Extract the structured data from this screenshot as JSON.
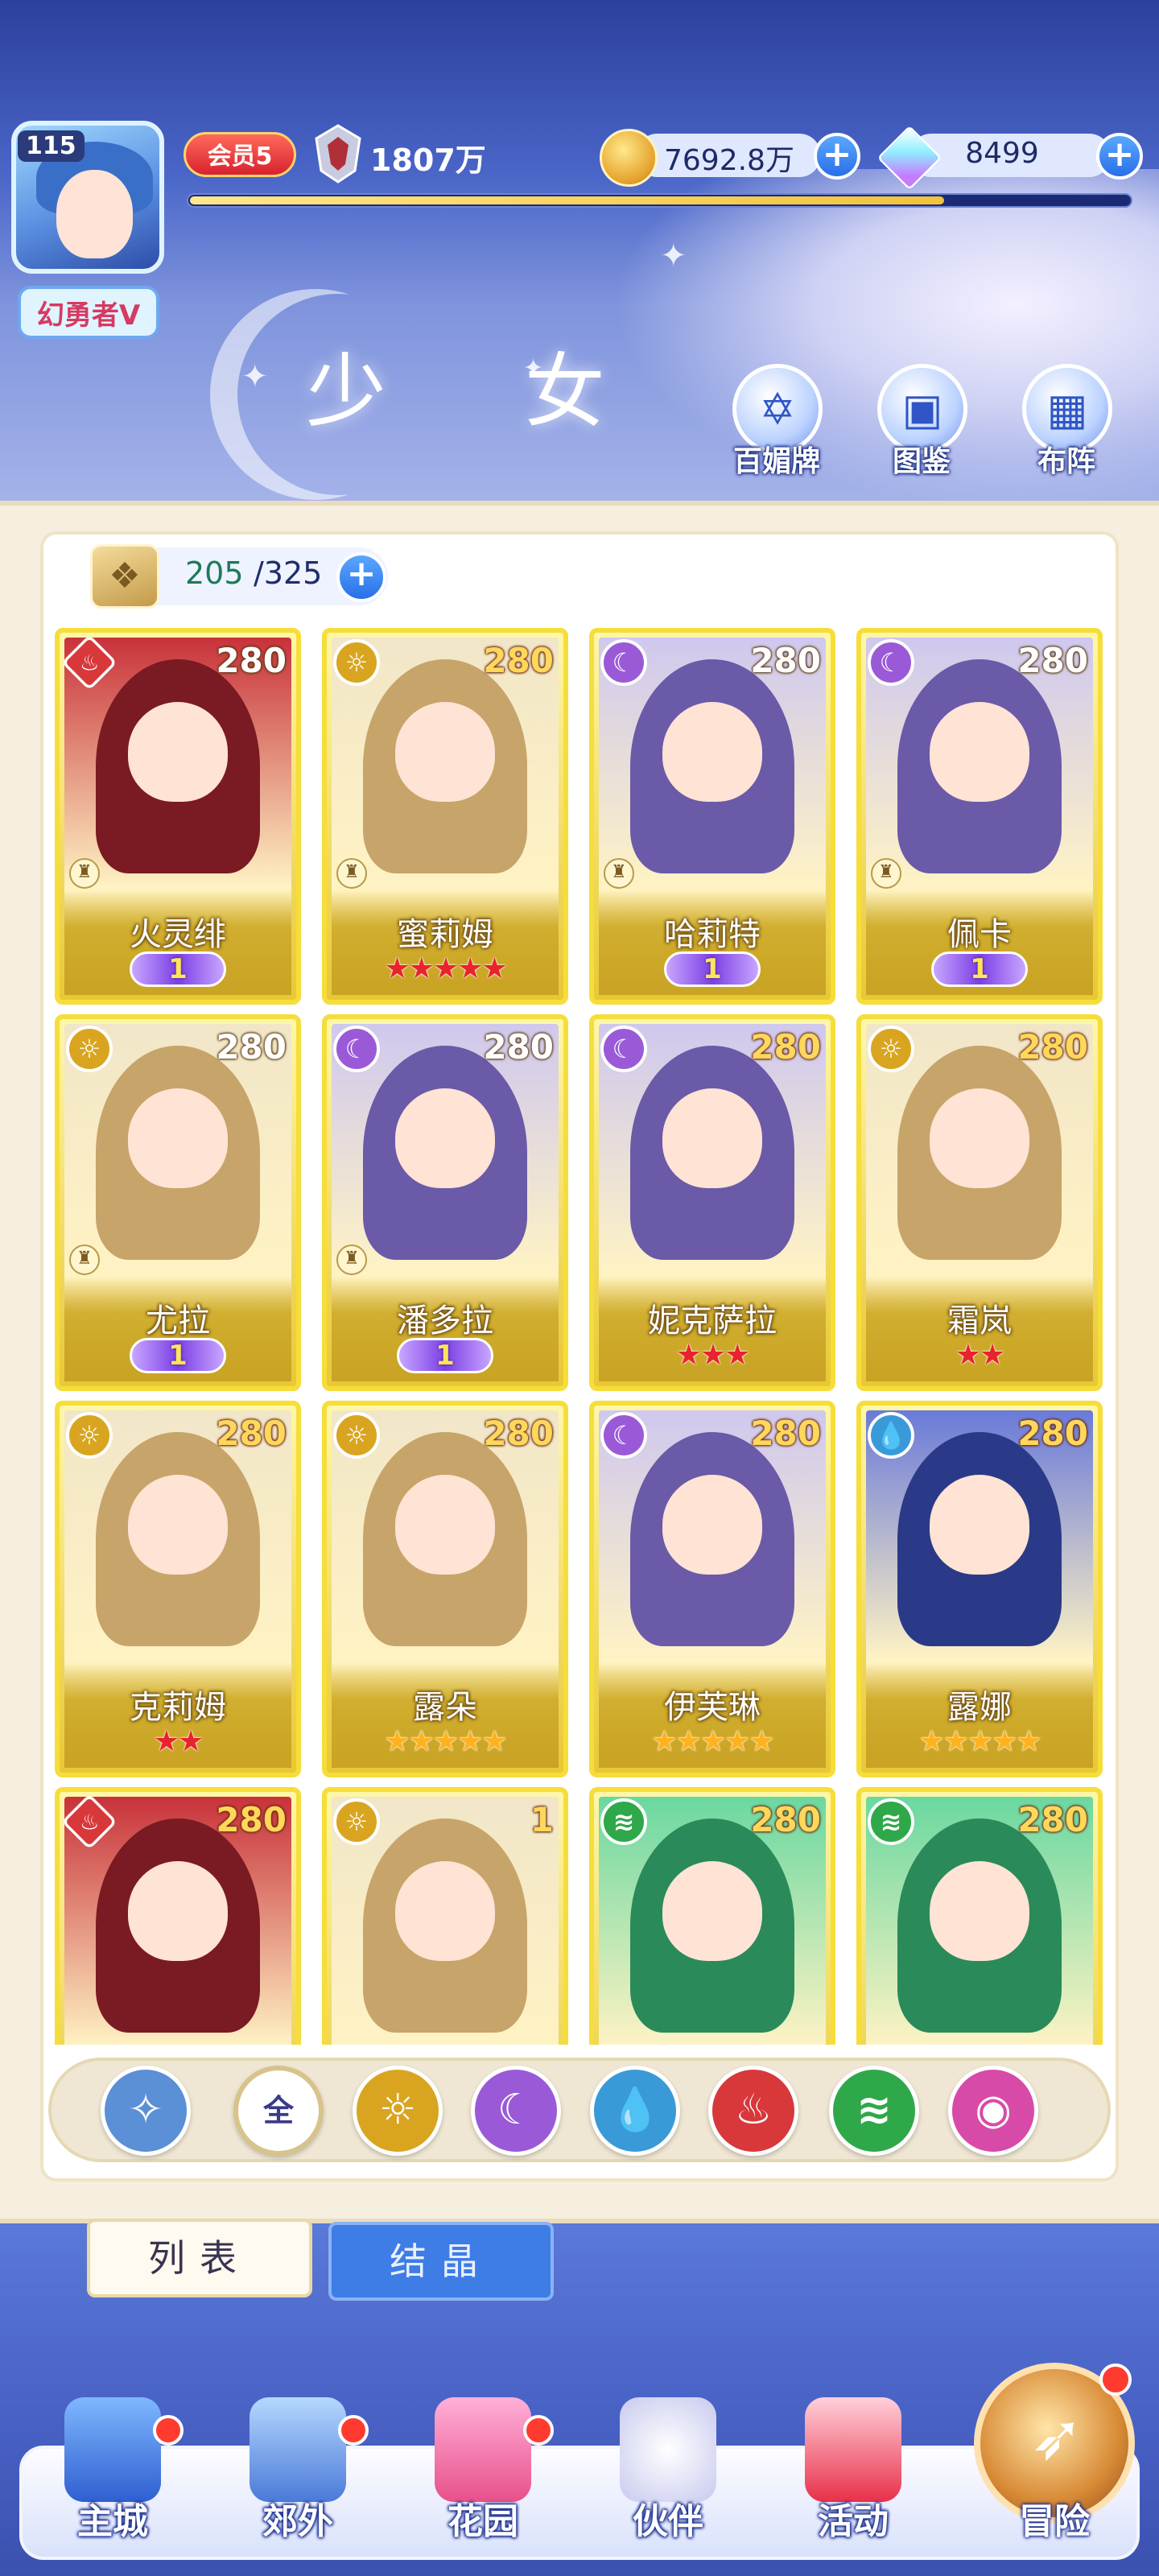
{
  "profile": {
    "level": "115",
    "name": "幻勇者V",
    "member_label": "会员5",
    "power": "1807万",
    "exp_fraction": 0.8
  },
  "currency": {
    "coins": "7692.8万",
    "gems": "8499"
  },
  "page_title": "少 女",
  "header_buttons": [
    {
      "label": "百媚牌",
      "icon": "star-badge-icon"
    },
    {
      "label": "图鉴",
      "icon": "book-icon"
    },
    {
      "label": "布阵",
      "icon": "grid-icon"
    }
  ],
  "collection": {
    "current": "205",
    "max": "/325"
  },
  "cards": [
    {
      "name": "火灵绯",
      "level": "280",
      "element": "fire",
      "stars": 0,
      "awaken": "1",
      "role": true
    },
    {
      "name": "蜜莉姆",
      "level": "280",
      "element": "light",
      "stars": 5,
      "star_color": "red",
      "role": true
    },
    {
      "name": "哈莉特",
      "level": "280",
      "element": "moon",
      "stars": 0,
      "awaken": "1",
      "role": true
    },
    {
      "name": "佩卡",
      "level": "280",
      "element": "moon",
      "stars": 0,
      "awaken": "1",
      "role": true
    },
    {
      "name": "尤拉",
      "level": "280",
      "element": "light",
      "stars": 0,
      "awaken": "1",
      "role": true
    },
    {
      "name": "潘多拉",
      "level": "280",
      "element": "moon",
      "stars": 0,
      "awaken": "1",
      "role": true
    },
    {
      "name": "妮克萨拉",
      "level": "280",
      "element": "moon",
      "stars": 3,
      "star_color": "red",
      "role": false
    },
    {
      "name": "霜岚",
      "level": "280",
      "element": "light",
      "stars": 2,
      "star_color": "red",
      "role": false
    },
    {
      "name": "克莉姆",
      "level": "280",
      "element": "light",
      "stars": 2,
      "star_color": "red",
      "role": false
    },
    {
      "name": "露朵",
      "level": "280",
      "element": "light",
      "stars": 5,
      "star_color": "gold",
      "role": false
    },
    {
      "name": "伊芙琳",
      "level": "280",
      "element": "moon",
      "stars": 5,
      "star_color": "gold",
      "role": false
    },
    {
      "name": "露娜",
      "level": "280",
      "element": "water",
      "stars": 5,
      "star_color": "gold",
      "role": false
    },
    {
      "name": "",
      "level": "280",
      "element": "fire",
      "stars": 0,
      "role": false
    },
    {
      "name": "",
      "level": "1",
      "element": "light",
      "stars": 0,
      "role": false
    },
    {
      "name": "",
      "level": "280",
      "element": "wind",
      "stars": 0,
      "role": false
    },
    {
      "name": "",
      "level": "280",
      "element": "wind",
      "stars": 0,
      "role": false
    }
  ],
  "filters": [
    {
      "id": "special",
      "label": "",
      "icon": "wing-star-icon",
      "color": "#5b8fd6"
    },
    {
      "id": "all",
      "label": "全",
      "icon": "all-icon",
      "color": "#ffffff"
    },
    {
      "id": "light",
      "label": "",
      "icon": "sun-icon",
      "color": "#d9a520"
    },
    {
      "id": "moon",
      "label": "",
      "icon": "moon-icon",
      "color": "#9a5ad8"
    },
    {
      "id": "water",
      "label": "",
      "icon": "water-icon",
      "color": "#3a9ad8"
    },
    {
      "id": "fire",
      "label": "",
      "icon": "flame-icon",
      "color": "#d8383a"
    },
    {
      "id": "wind",
      "label": "",
      "icon": "wind-icon",
      "color": "#2fa84a"
    },
    {
      "id": "dark",
      "label": "",
      "icon": "orb-icon",
      "color": "#d84aa8"
    }
  ],
  "tabs": {
    "list": "列表",
    "crystal": "结晶"
  },
  "nav": [
    {
      "label": "主城",
      "icon": "castle-icon",
      "badge": true
    },
    {
      "label": "郊外",
      "icon": "portal-icon",
      "badge": true
    },
    {
      "label": "花园",
      "icon": "heart-icon",
      "badge": true
    },
    {
      "label": "伙伴",
      "icon": "partner-icon",
      "badge": false,
      "active": true
    },
    {
      "label": "活动",
      "icon": "gift-icon",
      "badge": false
    },
    {
      "label": "冒险",
      "icon": "compass-icon",
      "badge": true
    }
  ],
  "colors": {
    "accent": "#3e7ce6",
    "card_border": "#f6dd3a",
    "panel_bg": "#f6efe0"
  }
}
